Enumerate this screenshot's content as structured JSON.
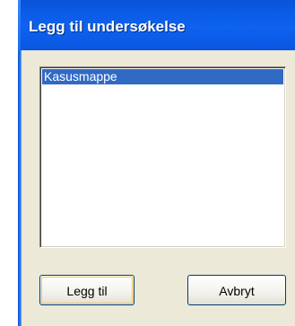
{
  "dialog": {
    "title": "Legg til undersøkelse",
    "list": {
      "items": [
        "Kasusmappe"
      ],
      "selected_index": 0
    },
    "buttons": {
      "add_label": "Legg til",
      "cancel_label": "Avbryt"
    }
  },
  "colors": {
    "titlebar": "#0b5ce6",
    "selection": "#316ac5",
    "dialog_bg": "#ece9d8"
  }
}
